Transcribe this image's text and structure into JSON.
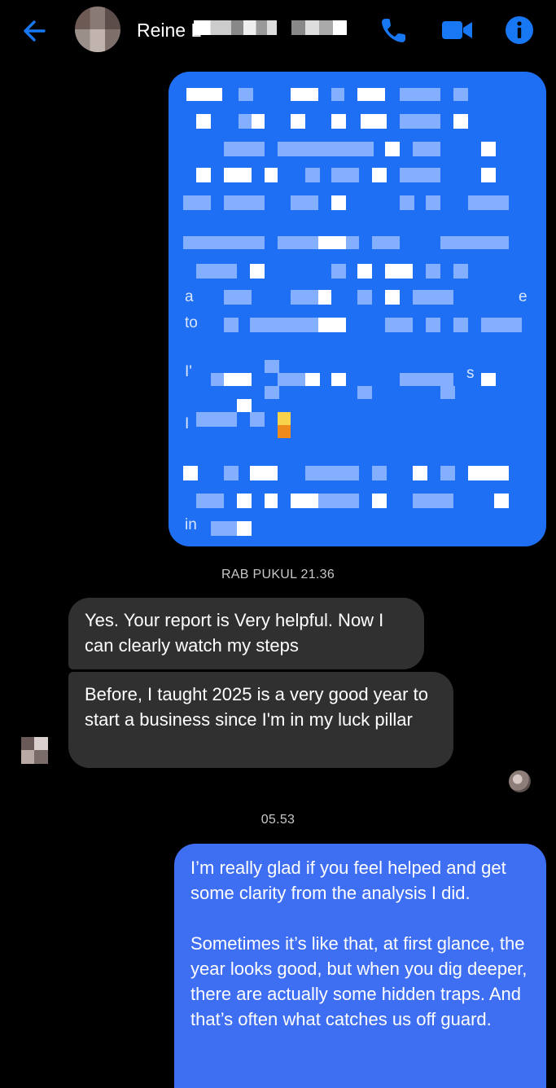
{
  "header": {
    "contact_name": "Reine L",
    "back_icon": "arrow-left-icon",
    "call_icon": "phone-icon",
    "video_icon": "video-camera-icon",
    "info_icon": "info-icon",
    "accent_color": "#1877f2"
  },
  "messages": {
    "blurred_fragments": [
      "a",
      "e",
      "to",
      "I'",
      "s",
      "I",
      "in"
    ],
    "timestamp_1": "RAB PUKUL 21.36",
    "received_1": "Yes. Your report is Very helpful.  Now I can clearly watch my steps",
    "received_2": "Before, I taught 2025 is a very good year to start a business since I'm in my luck pillar",
    "timestamp_2": "05.53",
    "sent_para_1": "I’m really glad if you feel helped and get some clarity from the analysis I did.",
    "sent_para_2": "Sometimes it’s like that, at first glance, the year looks good, but when you dig deeper, there are actually some hidden traps. And that’s often what catches us off guard."
  },
  "colors": {
    "bubble_sent_blurred": "#1f6ff5",
    "bubble_sent": "#3e6ef2",
    "bubble_received": "#303030"
  }
}
